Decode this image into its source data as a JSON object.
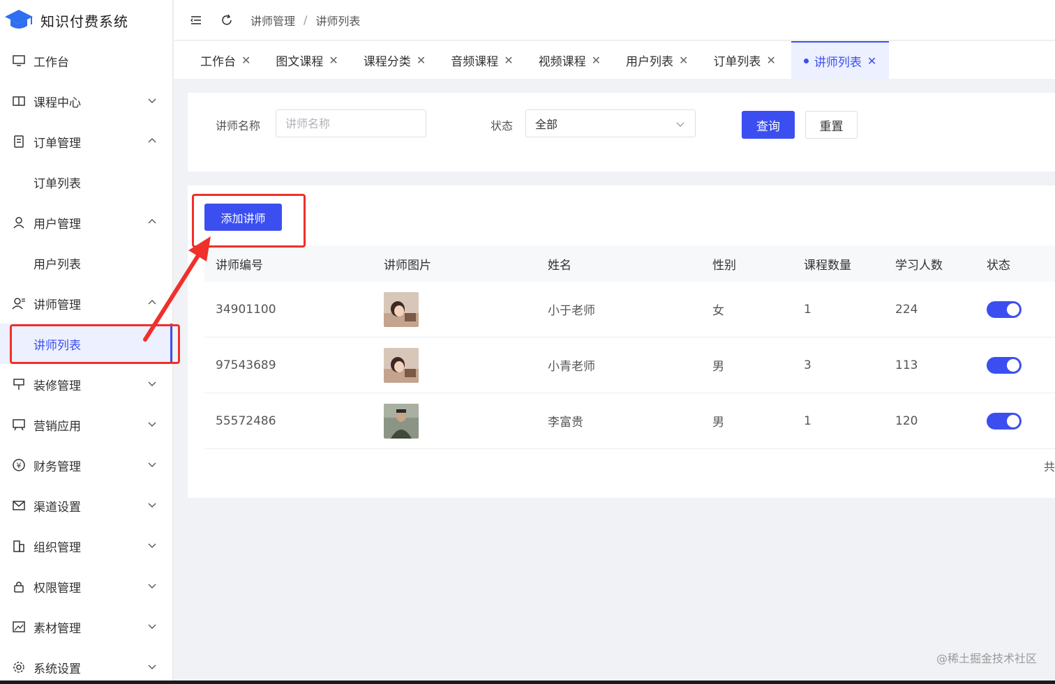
{
  "app": {
    "title": "知识付费系统"
  },
  "sidebar": {
    "items": [
      {
        "label": "工作台",
        "icon": "monitor-icon"
      },
      {
        "label": "课程中心",
        "icon": "book-icon"
      },
      {
        "label": "订单管理",
        "icon": "order-icon"
      },
      {
        "label": "订单列表"
      },
      {
        "label": "用户管理",
        "icon": "user-icon"
      },
      {
        "label": "用户列表"
      },
      {
        "label": "讲师管理",
        "icon": "teacher-icon"
      },
      {
        "label": "讲师列表"
      },
      {
        "label": "装修管理",
        "icon": "decoration-icon"
      },
      {
        "label": "营销应用",
        "icon": "marketing-icon"
      },
      {
        "label": "财务管理",
        "icon": "yen-icon"
      },
      {
        "label": "渠道设置",
        "icon": "mail-icon"
      },
      {
        "label": "组织管理",
        "icon": "building-icon"
      },
      {
        "label": "权限管理",
        "icon": "lock-icon"
      },
      {
        "label": "素材管理",
        "icon": "image-icon"
      },
      {
        "label": "系统设置",
        "icon": "gear-icon"
      }
    ]
  },
  "header": {
    "breadcrumb": [
      "讲师管理",
      "讲师列表"
    ],
    "breadcrumb_sep": "/"
  },
  "tabs": [
    {
      "label": "工作台"
    },
    {
      "label": "图文课程"
    },
    {
      "label": "课程分类"
    },
    {
      "label": "音频课程"
    },
    {
      "label": "视频课程"
    },
    {
      "label": "用户列表"
    },
    {
      "label": "订单列表"
    },
    {
      "label": "讲师列表"
    }
  ],
  "tab_close": "✕",
  "filter": {
    "name_label": "讲师名称",
    "name_placeholder": "讲师名称",
    "status_label": "状态",
    "status_value": "全部",
    "query_button": "查询",
    "reset_button": "重置"
  },
  "toolbar": {
    "add_button": "添加讲师"
  },
  "table": {
    "headers": [
      "讲师编号",
      "讲师图片",
      "姓名",
      "性别",
      "课程数量",
      "学习人数",
      "状态"
    ],
    "rows": [
      {
        "id": "34901100",
        "name": "小于老师",
        "gender": "女",
        "courses": "1",
        "learners": "224",
        "enabled": true
      },
      {
        "id": "97543689",
        "name": "小青老师",
        "gender": "男",
        "courses": "3",
        "learners": "113",
        "enabled": true
      },
      {
        "id": "55572486",
        "name": "李富贵",
        "gender": "男",
        "courses": "1",
        "learners": "120",
        "enabled": true
      }
    ]
  },
  "pager_fragment": "共",
  "watermark": "@稀土掘金技术社区",
  "colors": {
    "primary": "#3b4ff0",
    "annotation": "#f0302a"
  }
}
